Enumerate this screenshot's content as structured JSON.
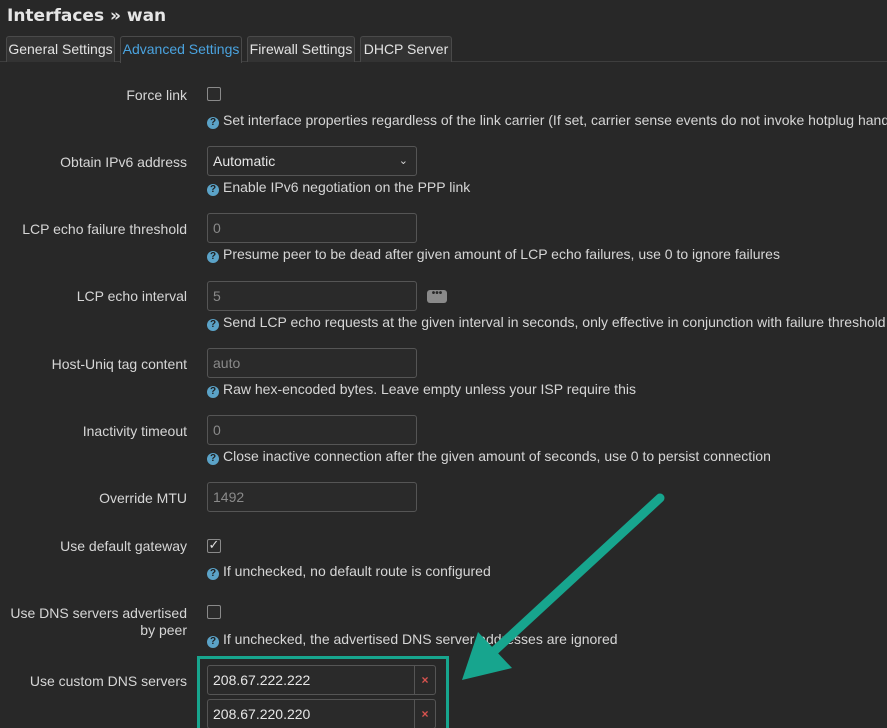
{
  "page": {
    "title": "Interfaces » wan"
  },
  "tabs": [
    {
      "label": "General Settings",
      "active": false
    },
    {
      "label": "Advanced Settings",
      "active": true
    },
    {
      "label": "Firewall Settings",
      "active": false
    },
    {
      "label": "DHCP Server",
      "active": false
    }
  ],
  "fields": {
    "force_link": {
      "label": "Force link",
      "checked": false,
      "help": "Set interface properties regardless of the link carrier (If set, carrier sense events do not invoke hotplug handlers)."
    },
    "ipv6": {
      "label": "Obtain IPv6 address",
      "value": "Automatic",
      "help": "Enable IPv6 negotiation on the PPP link"
    },
    "lcp_threshold": {
      "label": "LCP echo failure threshold",
      "placeholder": "0",
      "help": "Presume peer to be dead after given amount of LCP echo failures, use 0 to ignore failures"
    },
    "lcp_interval": {
      "label": "LCP echo interval",
      "placeholder": "5",
      "help": "Send LCP echo requests at the given interval in seconds, only effective in conjunction with failure threshold"
    },
    "host_uniq": {
      "label": "Host-Uniq tag content",
      "placeholder": "auto",
      "help": "Raw hex-encoded bytes. Leave empty unless your ISP require this"
    },
    "inactivity": {
      "label": "Inactivity timeout",
      "placeholder": "0",
      "help": "Close inactive connection after the given amount of seconds, use 0 to persist connection"
    },
    "mtu": {
      "label": "Override MTU",
      "placeholder": "1492"
    },
    "default_gw": {
      "label": "Use default gateway",
      "checked": true,
      "help": "If unchecked, no default route is configured"
    },
    "peer_dns": {
      "label_line1": "Use DNS servers advertised",
      "label_line2": "by peer",
      "checked": false,
      "help": "If unchecked, the advertised DNS server addresses are ignored"
    },
    "custom_dns": {
      "label": "Use custom DNS servers",
      "servers": [
        "208.67.222.222",
        "208.67.220.220"
      ],
      "remove_label": "×"
    }
  },
  "icons": {
    "help": "question-circle-icon",
    "more": "ellipsis-icon",
    "remove": "remove-x-icon",
    "annotation_arrow": "arrow-icon"
  },
  "colors": {
    "accent": "#4aa3df",
    "annotation": "#17a58e",
    "remove": "#d9534f"
  }
}
